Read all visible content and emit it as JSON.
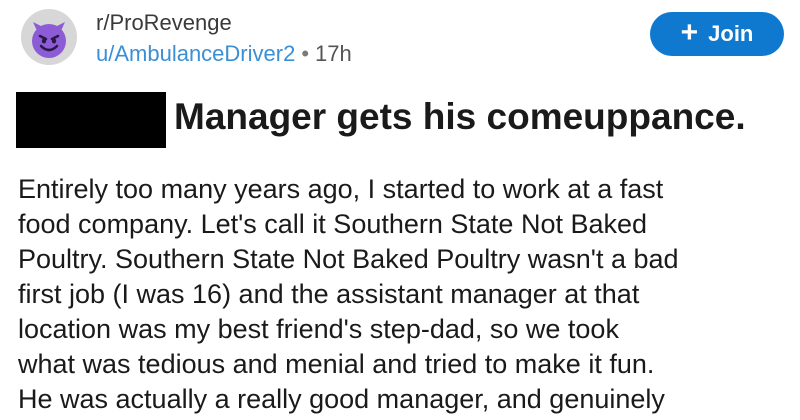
{
  "post": {
    "subreddit": "r/ProRevenge",
    "username": "u/AmbulanceDriver2",
    "separator": "•",
    "age": "17h",
    "join_label": "Join",
    "join_icon": "plus-icon",
    "avatar_icon": "smiling-devil-icon",
    "title": "Manager gets his comeuppance.",
    "body_lines": [
      "Entirely too many years ago, I started to work at a fast",
      "food company.  Let's call it Southern State Not Baked",
      "Poultry.  Southern State Not Baked Poultry wasn't a bad",
      "first job (I was 16) and the assistant manager at that",
      "location was my best friend's step-dad, so we took",
      "what was tedious and menial and tried to make it fun.",
      "He was actually a really good manager, and genuinely"
    ]
  },
  "colors": {
    "username": "#3a8fd6",
    "join_button": "#0f79d0",
    "avatar_face": "#8c5bd6"
  }
}
